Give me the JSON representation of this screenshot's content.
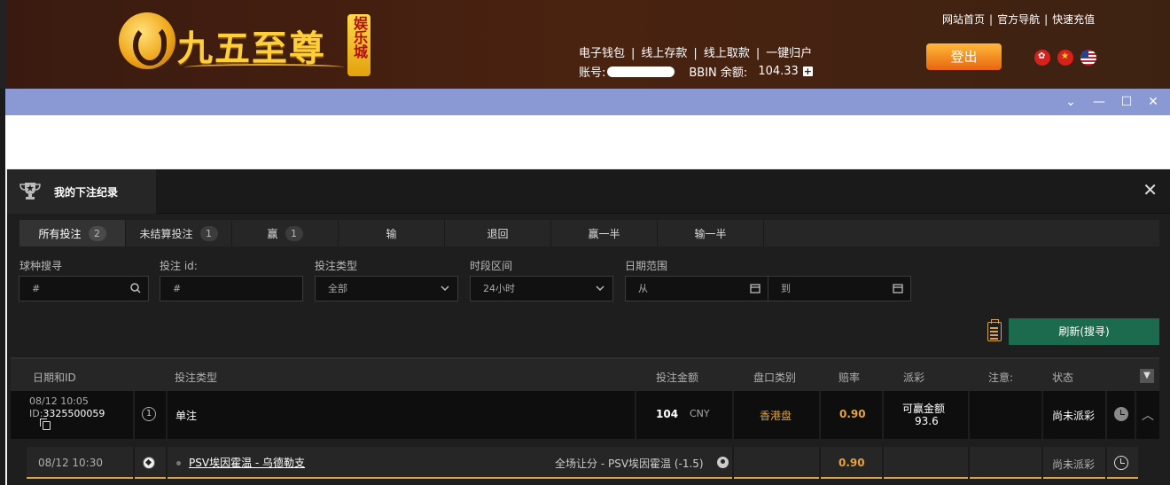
{
  "site": {
    "logo_text": "九五至尊",
    "logo_badge": "娱乐城",
    "top_nav": [
      "网站首页",
      "官方导航",
      "快速充值"
    ],
    "wallet_links": [
      "电子钱包",
      "线上存款",
      "线上取款",
      "一键归户"
    ],
    "account_label": "账号:",
    "balance_label": "BBIN 余额:",
    "balance_value": "104.33",
    "logout_label": "登出",
    "lang_flags": [
      "hk-flag-icon",
      "cn-flag-icon",
      "us-flag-icon"
    ]
  },
  "window": {
    "controls": [
      "⌄",
      "—",
      "☐",
      "✕"
    ]
  },
  "panel": {
    "title": "我的下注纪录",
    "tabs": [
      {
        "label": "所有投注",
        "count": "2"
      },
      {
        "label": "未结算投注",
        "count": "1"
      },
      {
        "label": "赢",
        "count": "1"
      },
      {
        "label": "输",
        "count": ""
      },
      {
        "label": "退回",
        "count": ""
      },
      {
        "label": "赢一半",
        "count": ""
      },
      {
        "label": "输一半",
        "count": ""
      }
    ],
    "filters": {
      "sport_label": "球种搜寻",
      "sport_placeholder": "#",
      "bet_id_label": "投注 id:",
      "bet_id_placeholder": "#",
      "bet_type_label": "投注类型",
      "bet_type_value": "全部",
      "period_label": "时段区间",
      "period_value": "24小时",
      "date_label": "日期范围",
      "date_from": "从",
      "date_to": "到"
    },
    "refresh_label": "刷新(搜寻)",
    "columns": [
      "日期和ID",
      "投注类型",
      "投注金额",
      "盘口类别",
      "赔率",
      "派彩",
      "注意:",
      "状态"
    ],
    "bet": {
      "date": "08/12 10:05",
      "id_label": "ID:",
      "id": "3325500059",
      "legs": "1",
      "type": "单注",
      "amount": "104",
      "currency": "CNY",
      "market": "香港盘",
      "odds": "0.90",
      "payout_label": "可赢金额",
      "payout_value": "93.6",
      "status": "尚未派彩"
    },
    "leg": {
      "date": "08/12 10:30",
      "match": "PSV埃因霍温 - 乌德勒支",
      "selection": "全场让分 - PSV埃因霍温 (-1.5)",
      "odds": "0.90",
      "status": "尚未派彩"
    }
  },
  "colors": {
    "accent_gold": "#d9a441",
    "odds_orange": "#e8a33c",
    "refresh_green": "#1d6b4f",
    "titlebar_blue": "#8a98d4"
  }
}
